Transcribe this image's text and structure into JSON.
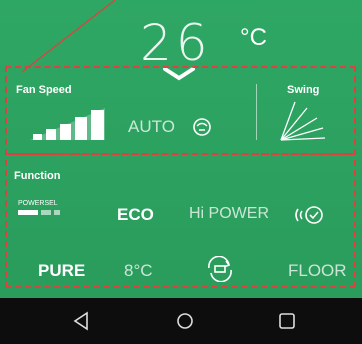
{
  "display": {
    "temperature": "26",
    "unit": "°C"
  },
  "fan_speed": {
    "label": "Fan Speed",
    "mode": "AUTO",
    "level": 5
  },
  "swing": {
    "label": "Swing"
  },
  "function": {
    "label": "Function",
    "row1": {
      "power_label": "POWERSEL",
      "eco": "ECO",
      "hipower": "Hi POWER"
    },
    "row2": {
      "pure": "PURE",
      "eight": "8°C",
      "floor": "FLOOR"
    }
  },
  "colors": {
    "accent": "#2fa764",
    "annotation": "#e0403f"
  },
  "icons": {
    "nav_back": "back-triangle-icon",
    "nav_home": "home-circle-icon",
    "nav_recent": "recent-square-icon"
  }
}
